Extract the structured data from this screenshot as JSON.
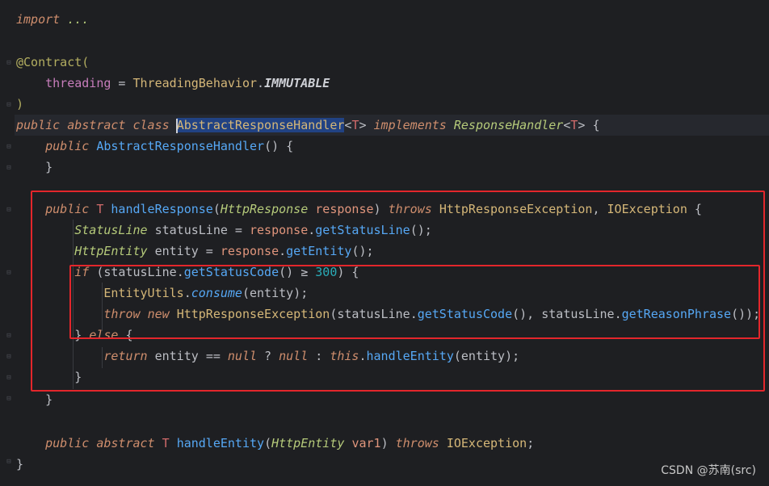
{
  "code": {
    "import_kw": "import",
    "import_dots": "...",
    "annotation": "@Contract(",
    "threading_field": "threading",
    "equals": " = ",
    "behavior_class": "ThreadingBehavior",
    "dot": ".",
    "immutable": "IMMUTABLE",
    "close_paren": ")",
    "public": "public",
    "abstract": "abstract",
    "class": "class",
    "class_name": "AbstractResponseHandler",
    "type_param": "T",
    "implements": "implements",
    "interface_name": "ResponseHandler",
    "ctor_name": "AbstractResponseHandler",
    "handle_response": "handleResponse",
    "http_response": "HttpResponse",
    "response": "response",
    "throws": "throws",
    "http_response_exception": "HttpResponseException",
    "io_exception": "IOException",
    "status_line_type": "StatusLine",
    "status_line_var": "statusLine",
    "get_status_line": "getStatusLine",
    "http_entity": "HttpEntity",
    "entity": "entity",
    "get_entity": "getEntity",
    "if": "if",
    "get_status_code": "getStatusCode",
    "gte": "≥",
    "threshold": "300",
    "entity_utils": "EntityUtils",
    "consume": "consume",
    "throw": "throw",
    "new": "new",
    "get_reason_phrase": "getReasonPhrase",
    "else": "else",
    "return": "return",
    "eqeq": "==",
    "null": "null",
    "this": "this",
    "handle_entity": "handleEntity",
    "var1": "var1"
  },
  "watermark": "CSDN @苏南(src)",
  "colors": {
    "background": "#1e1f22",
    "highlight_box": "#e3262b"
  }
}
